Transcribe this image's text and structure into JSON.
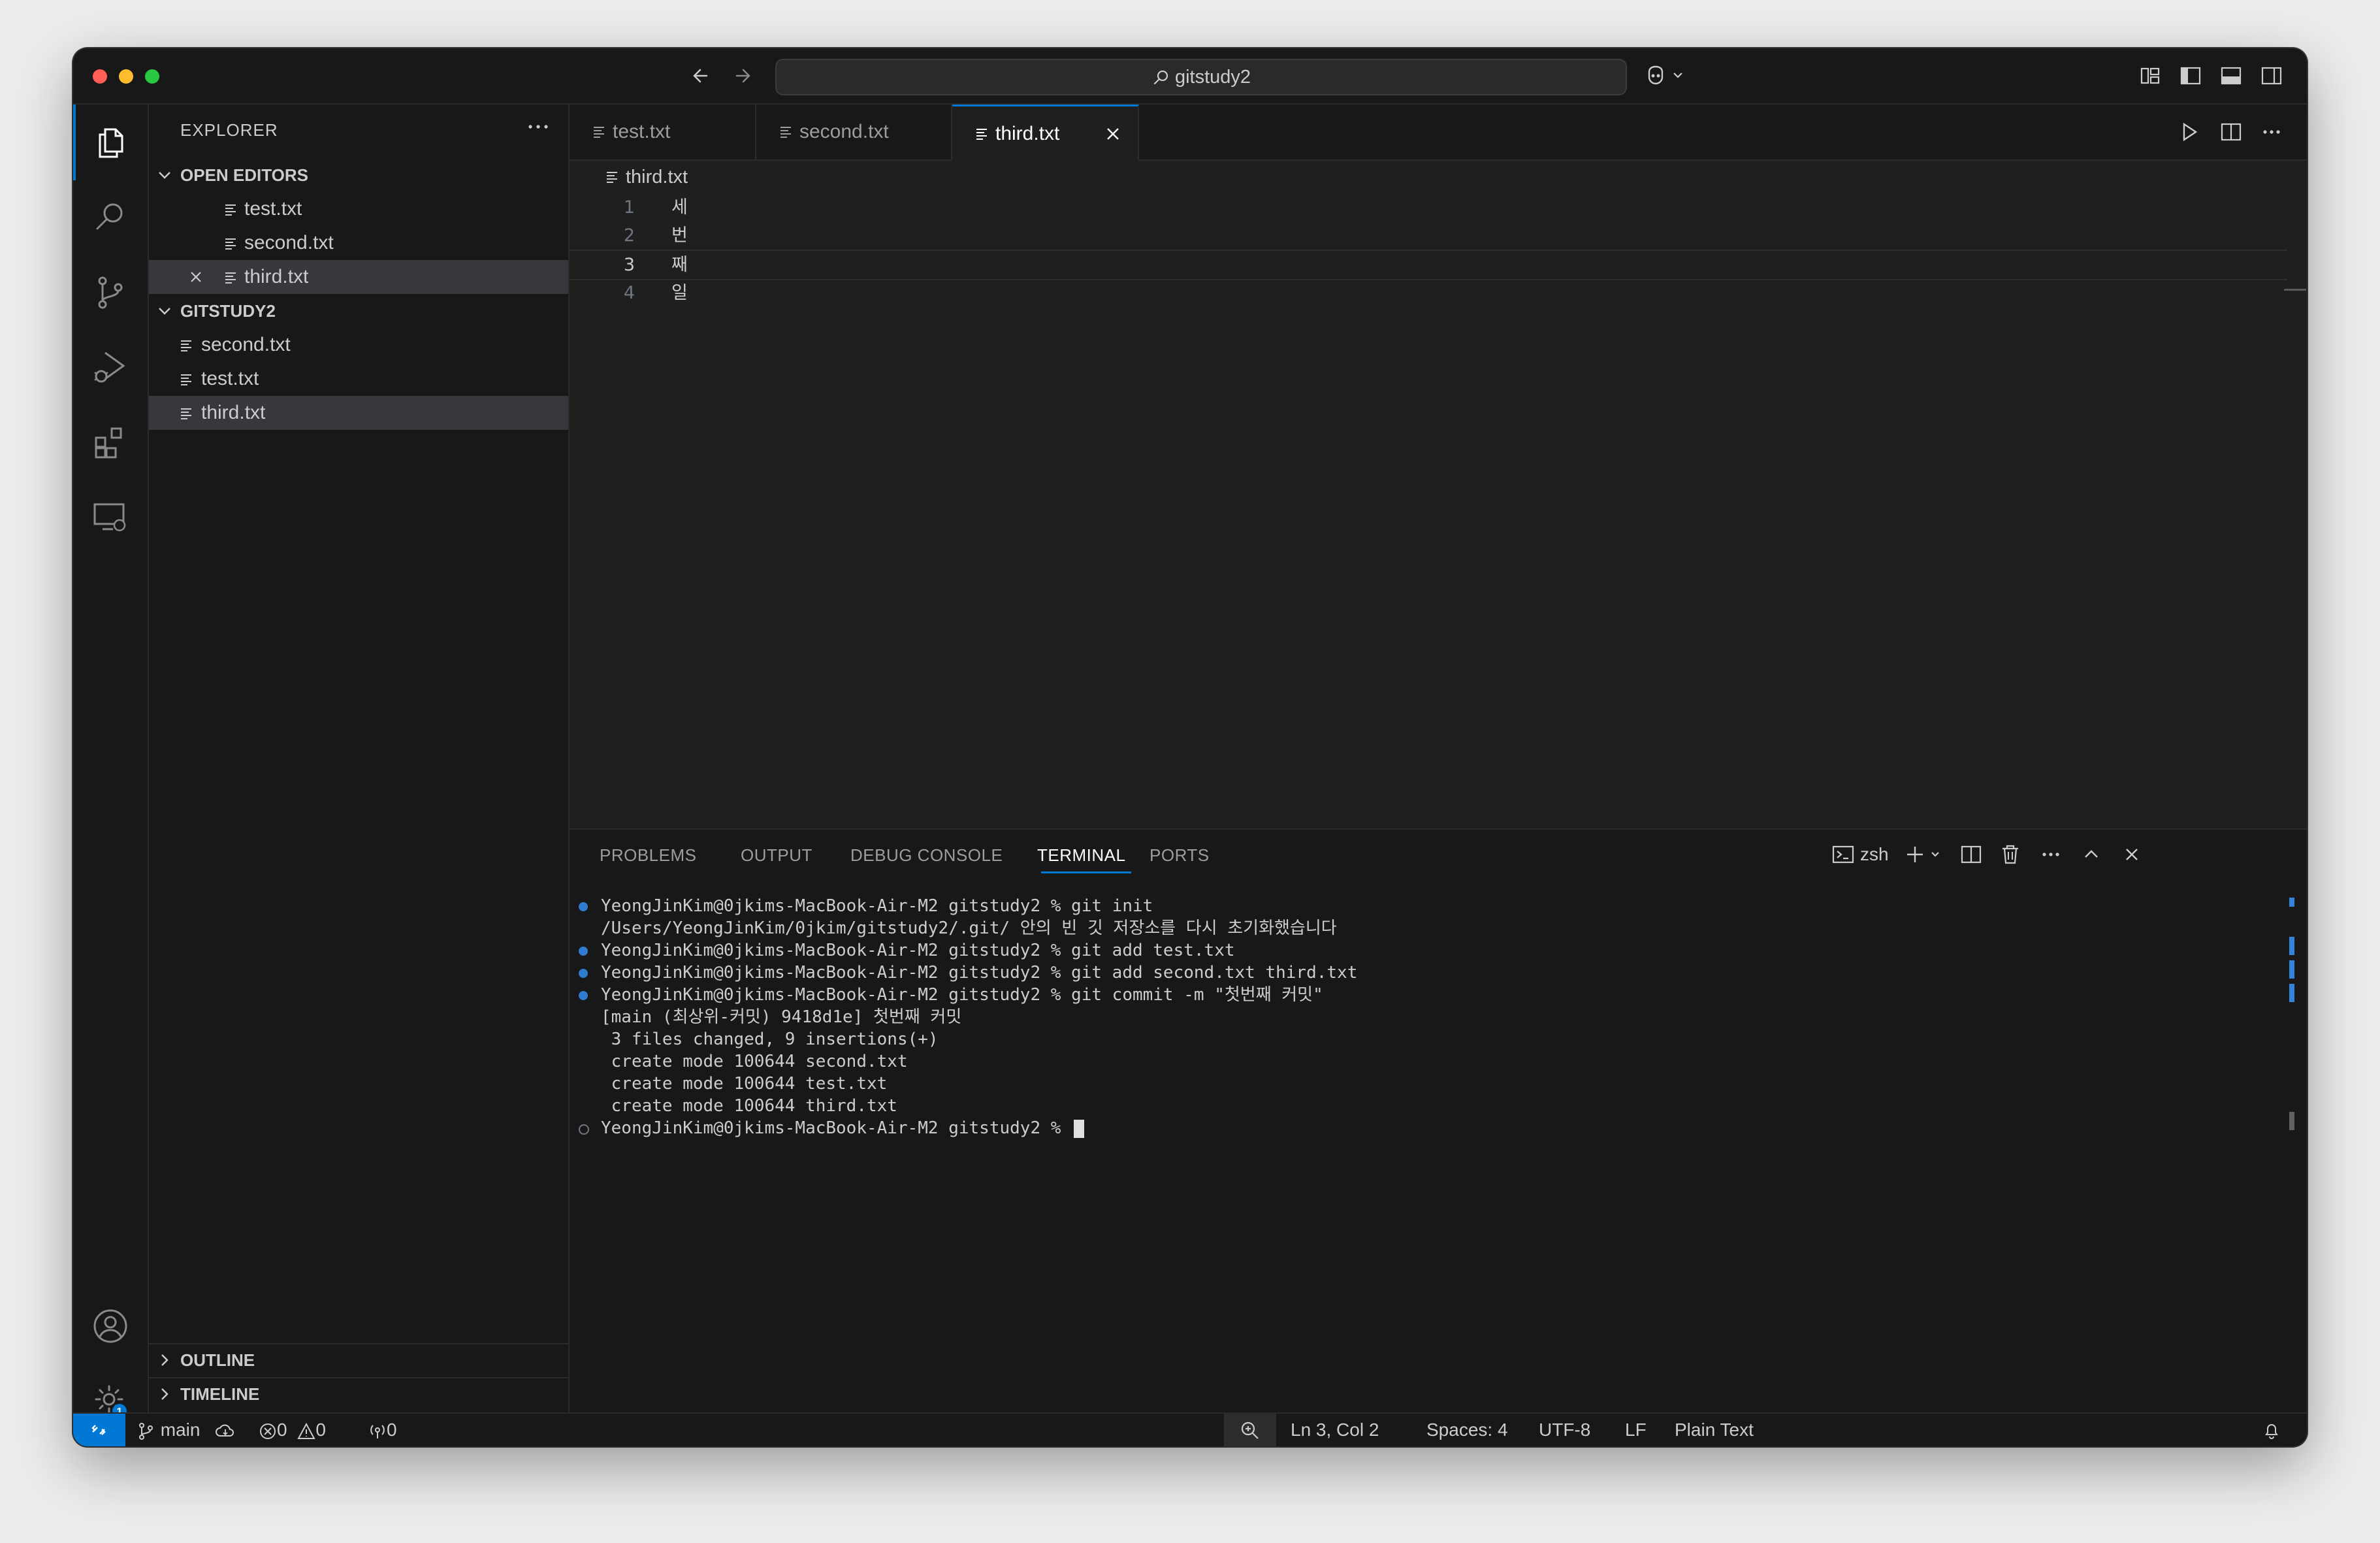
{
  "titlebar": {
    "search_text": "gitstudy2"
  },
  "sidebar": {
    "title": "EXPLORER",
    "open_editors": {
      "label": "OPEN EDITORS",
      "items": [
        "test.txt",
        "second.txt",
        "third.txt"
      ]
    },
    "folder": {
      "label": "GITSTUDY2",
      "items": [
        "second.txt",
        "test.txt",
        "third.txt"
      ]
    },
    "outline_label": "OUTLINE",
    "timeline_label": "TIMELINE"
  },
  "settings_badge": "1",
  "tabs": [
    {
      "label": "test.txt"
    },
    {
      "label": "second.txt"
    },
    {
      "label": "third.txt"
    }
  ],
  "breadcrumb": {
    "file": "third.txt"
  },
  "editor": {
    "lines": [
      {
        "num": "1",
        "text": "세"
      },
      {
        "num": "2",
        "text": "번"
      },
      {
        "num": "3",
        "text": "째"
      },
      {
        "num": "4",
        "text": "일"
      }
    ]
  },
  "panel": {
    "tabs": [
      "PROBLEMS",
      "OUTPUT",
      "DEBUG CONSOLE",
      "TERMINAL",
      "PORTS"
    ],
    "active_tab": "TERMINAL",
    "shell": "zsh",
    "terminal_lines": [
      "YeongJinKim@0jkims-MacBook-Air-M2 gitstudy2 % git init",
      "/Users/YeongJinKim/0jkim/gitstudy2/.git/ 안의 빈 깃 저장소를 다시 초기화했습니다",
      "YeongJinKim@0jkims-MacBook-Air-M2 gitstudy2 % git add test.txt",
      "YeongJinKim@0jkims-MacBook-Air-M2 gitstudy2 % git add second.txt third.txt",
      "YeongJinKim@0jkims-MacBook-Air-M2 gitstudy2 % git commit -m \"첫번째 커밋\"",
      "[main (최상위-커밋) 9418d1e] 첫번째 커밋",
      " 3 files changed, 9 insertions(+)",
      " create mode 100644 second.txt",
      " create mode 100644 test.txt",
      " create mode 100644 third.txt",
      "YeongJinKim@0jkims-MacBook-Air-M2 gitstudy2 % "
    ]
  },
  "statusbar": {
    "branch": "main",
    "errors": "0",
    "warnings": "0",
    "ports": "0",
    "position": "Ln 3, Col 2",
    "spaces": "Spaces: 4",
    "encoding": "UTF-8",
    "eol": "LF",
    "language": "Plain Text"
  },
  "colors": {
    "accent": "#0078d4",
    "background": "#1f1f1f",
    "sidebar": "#181818",
    "selection": "#37373d"
  }
}
